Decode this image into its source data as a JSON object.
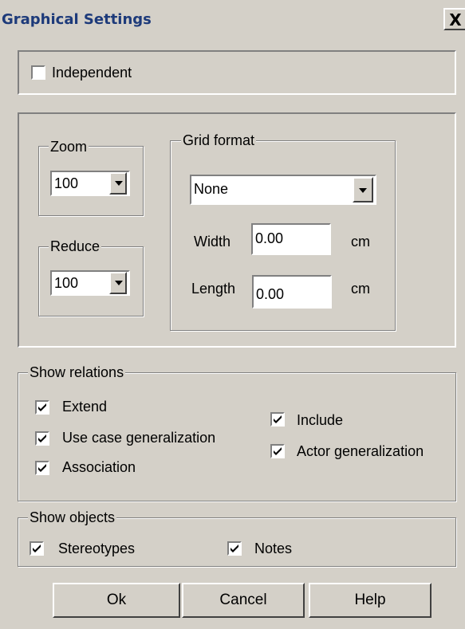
{
  "window": {
    "title": "Graphical Settings",
    "close_glyph": "X"
  },
  "independent": {
    "label": "Independent",
    "checked": false
  },
  "zoom": {
    "label": "Zoom",
    "value": "100"
  },
  "reduce": {
    "label": "Reduce",
    "value": "100"
  },
  "grid": {
    "label": "Grid format",
    "format": "None",
    "width_label": "Width",
    "width_value": "0.00",
    "width_unit": "cm",
    "length_label": "Length",
    "length_value": "0.00",
    "length_unit": "cm"
  },
  "relations": {
    "label": "Show relations",
    "extend": "Extend",
    "use_case_gen": "Use case generalization",
    "association": "Association",
    "include": "Include",
    "actor_gen": "Actor generalization"
  },
  "objects": {
    "label": "Show objects",
    "stereotypes": "Stereotypes",
    "notes": "Notes"
  },
  "buttons": {
    "ok": "Ok",
    "cancel": "Cancel",
    "help": "Help"
  }
}
